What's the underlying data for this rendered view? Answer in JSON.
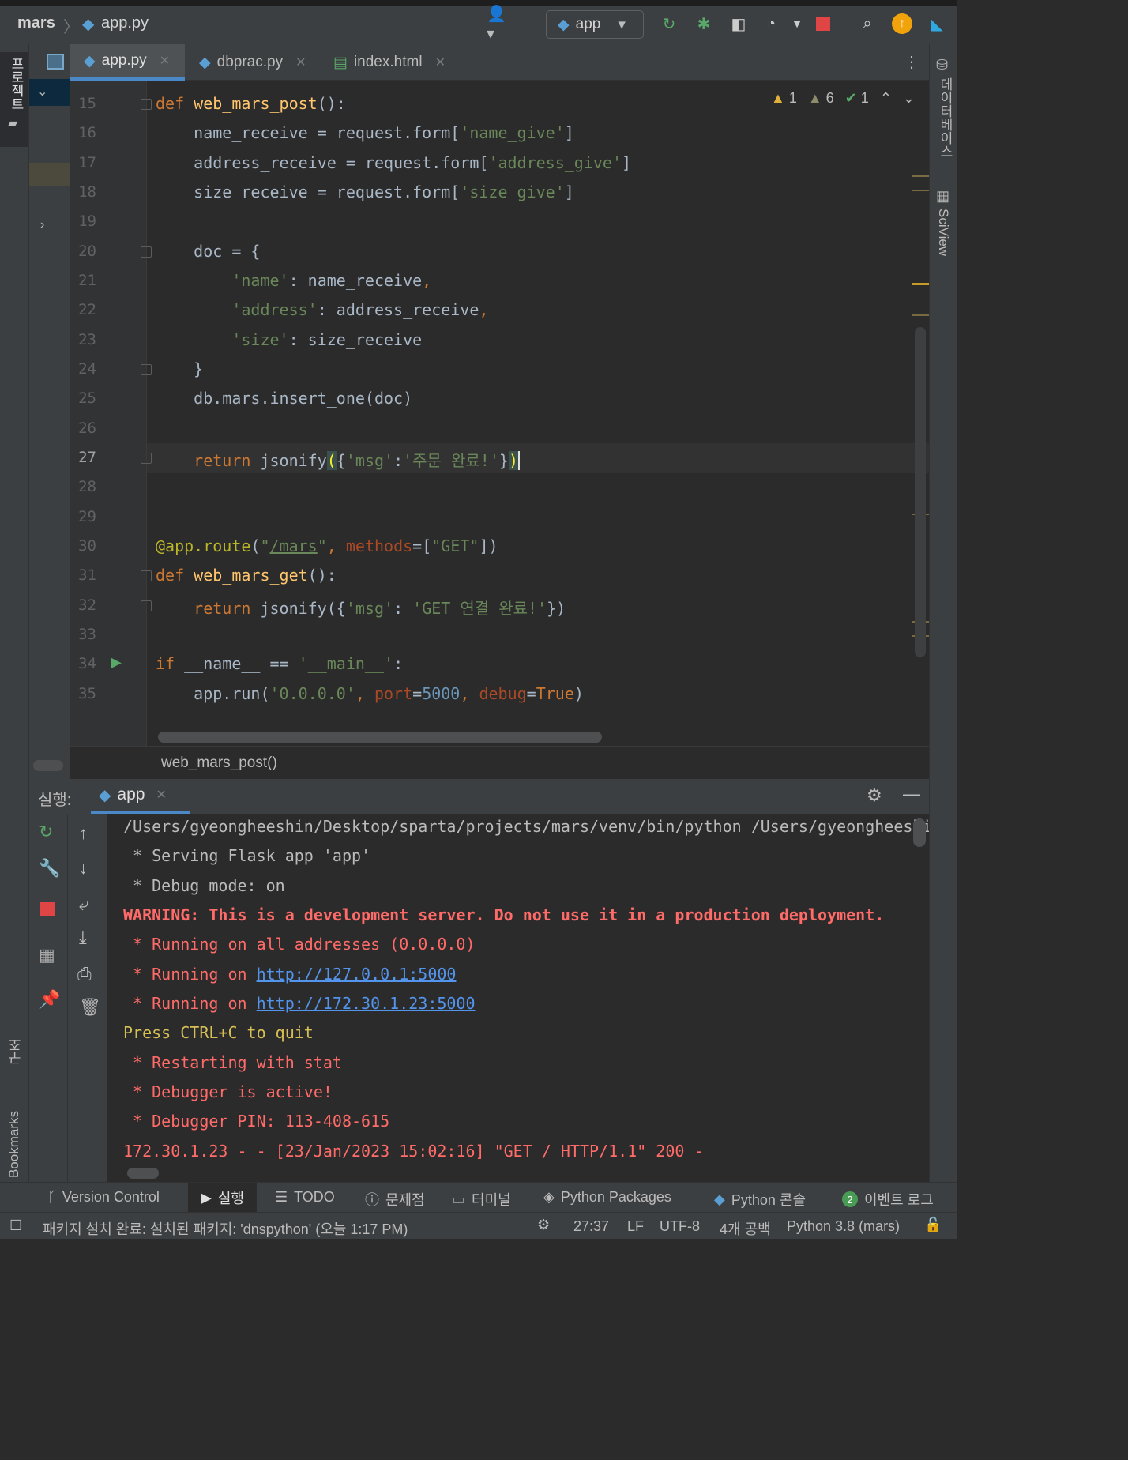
{
  "titlebar": {
    "project": "mars",
    "file": "app.py",
    "run_config": "app"
  },
  "tabs": [
    {
      "label": "app.py"
    },
    {
      "label": "dbprac.py"
    },
    {
      "label": "index.html"
    }
  ],
  "left_strip": {
    "project": "프로젝트",
    "structure": "구조",
    "bookmarks": "Bookmarks"
  },
  "right_strip": {
    "database": "데이터베이스",
    "sciview": "SciView"
  },
  "inspections": {
    "warnings": "1",
    "weak_warnings": "6",
    "typos": "1"
  },
  "editor": {
    "line_numbers": [
      "15",
      "16",
      "17",
      "18",
      "19",
      "20",
      "21",
      "22",
      "23",
      "24",
      "25",
      "26",
      "27",
      "28",
      "29",
      "30",
      "31",
      "32",
      "33",
      "34",
      "35"
    ],
    "current_line": "27",
    "breadcrumb": "web_mars_post()"
  },
  "run_panel": {
    "label": "실행:",
    "tab": "app",
    "console": [
      "/Users/gyeongheeshin/Desktop/sparta/projects/mars/venv/bin/python /Users/gyeongheeshin/",
      " * Serving Flask app 'app'",
      " * Debug mode: on",
      "WARNING: This is a development server. Do not use it in a production deployment.",
      " * Running on all addresses (0.0.0.0)",
      " * Running on ",
      "http://127.0.0.1:5000",
      " * Running on ",
      "http://172.30.1.23:5000",
      "Press CTRL+C to quit",
      " * Restarting with stat",
      " * Debugger is active!",
      " * Debugger PIN: 113-408-615",
      "172.30.1.23 - - [23/Jan/2023 15:02:16] \"GET / HTTP/1.1\" 200 -"
    ]
  },
  "bottom_tabs": [
    "Version Control",
    "실행",
    "TODO",
    "문제점",
    "터미널",
    "Python Packages",
    "Python 콘솔",
    "이벤트 로그"
  ],
  "event_count": "2",
  "status": {
    "message": "패키지 설치 완료: 설치된 패키지: 'dnspython' (오늘 1:17 PM)",
    "position": "27:37",
    "line_sep": "LF",
    "encoding": "UTF-8",
    "indent": "4개 공백",
    "interpreter": "Python 3.8 (mars)"
  }
}
